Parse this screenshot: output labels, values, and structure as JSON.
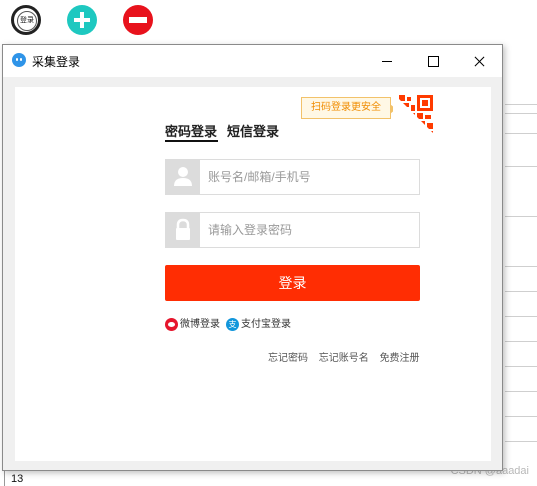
{
  "background": {
    "toolbar": {
      "login_button_label": "登录",
      "add_icon": "plus-circle-icon",
      "remove_icon": "minus-circle-icon"
    },
    "row_number": "13",
    "watermark": "CSDN @aaadai"
  },
  "window": {
    "title": "采集登录",
    "controls": [
      "minimize",
      "maximize",
      "close"
    ]
  },
  "login": {
    "qr_tip": "扫码登录更安全",
    "tabs": [
      {
        "label": "密码登录",
        "active": true
      },
      {
        "label": "短信登录",
        "active": false
      }
    ],
    "username": {
      "value": "",
      "placeholder": "账号名/邮箱/手机号"
    },
    "password": {
      "value": "",
      "placeholder": "请输入登录密码"
    },
    "submit_label": "登录",
    "social": {
      "weibo": "微博登录",
      "alipay": "支付宝登录",
      "alipay_icon_text": "支"
    },
    "links": {
      "forgot_password": "忘记密码",
      "forgot_username": "忘记账号名",
      "register": "免费注册"
    }
  },
  "colors": {
    "accent": "#ff2d03",
    "tip_text": "#f08c00",
    "teal": "#1ec8c0",
    "red": "#e8121c"
  }
}
